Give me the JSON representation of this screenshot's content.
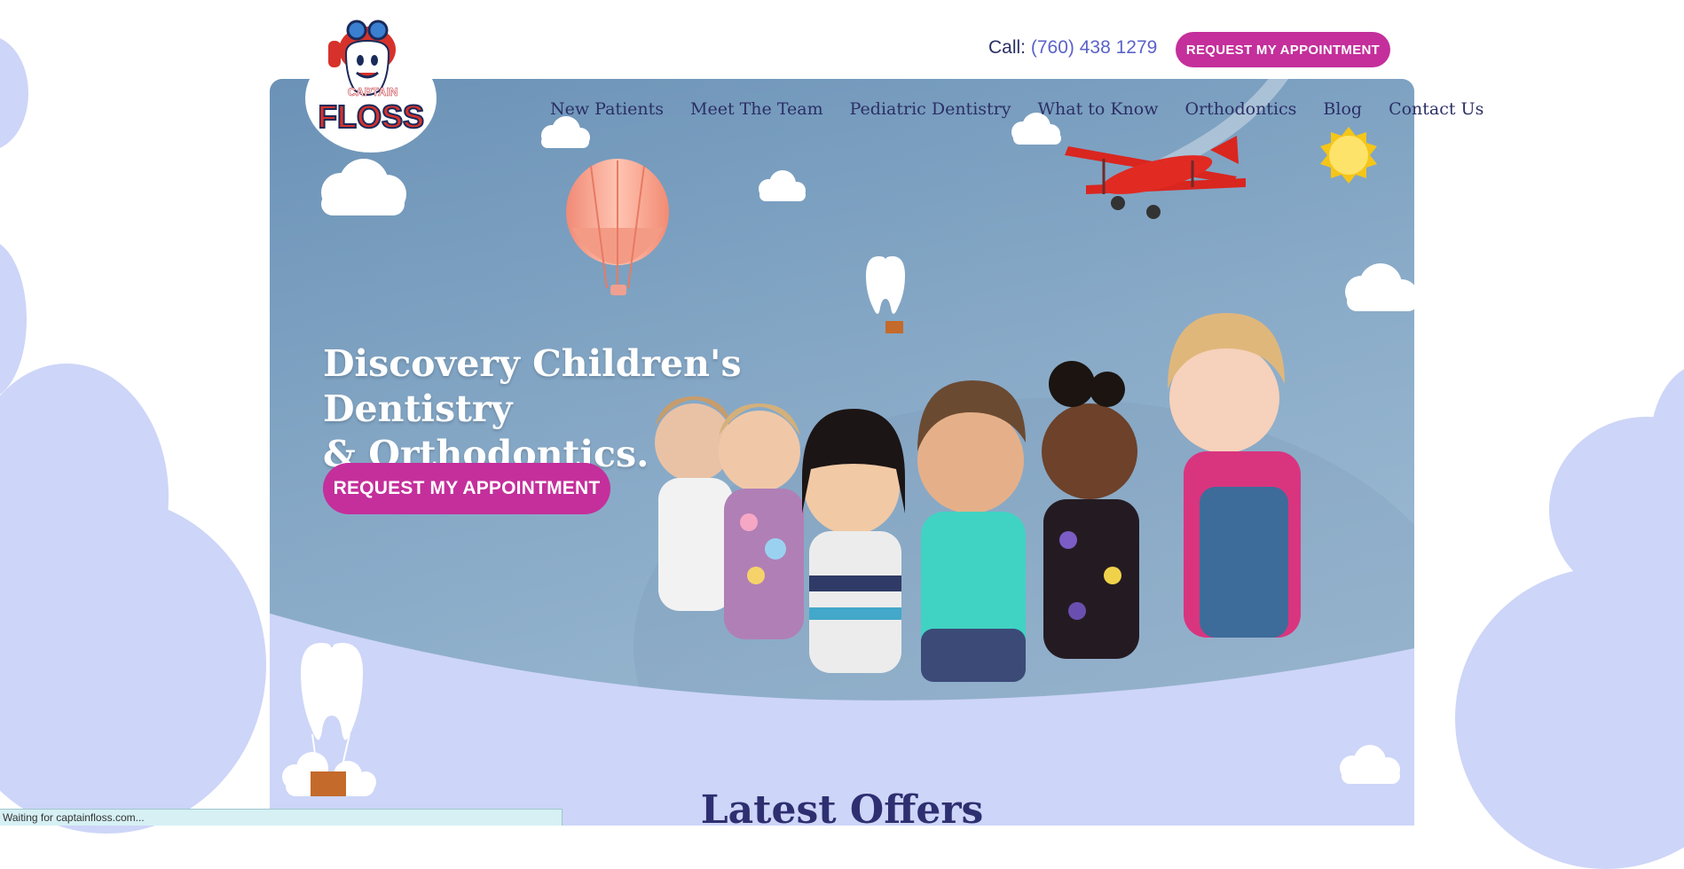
{
  "brand": {
    "logo_word_top": "CAPTAIN",
    "logo_word_main": "FLOSS"
  },
  "topbar": {
    "call_label": "Call:",
    "phone": "(760) 438 1279",
    "cta_label": "REQUEST MY APPOINTMENT"
  },
  "nav": {
    "items": [
      {
        "label": "New Patients"
      },
      {
        "label": "Meet The Team"
      },
      {
        "label": "Pediatric Dentistry"
      },
      {
        "label": "What to Know"
      },
      {
        "label": "Orthodontics"
      },
      {
        "label": "Blog"
      },
      {
        "label": "Contact Us"
      }
    ]
  },
  "hero": {
    "title_line1": "Discovery Children's Dentistry",
    "title_line2": "& Orthodontics.",
    "cta_label": "REQUEST MY APPOINTMENT"
  },
  "offers": {
    "heading": "Latest Offers"
  },
  "status": {
    "text": "Waiting for captainfloss.com..."
  },
  "colors": {
    "accent_pink": "#c42f9b",
    "nav_text": "#2b2f66",
    "lavender_bg": "#cdd5f8",
    "hero_blue": "#86a9c7"
  }
}
